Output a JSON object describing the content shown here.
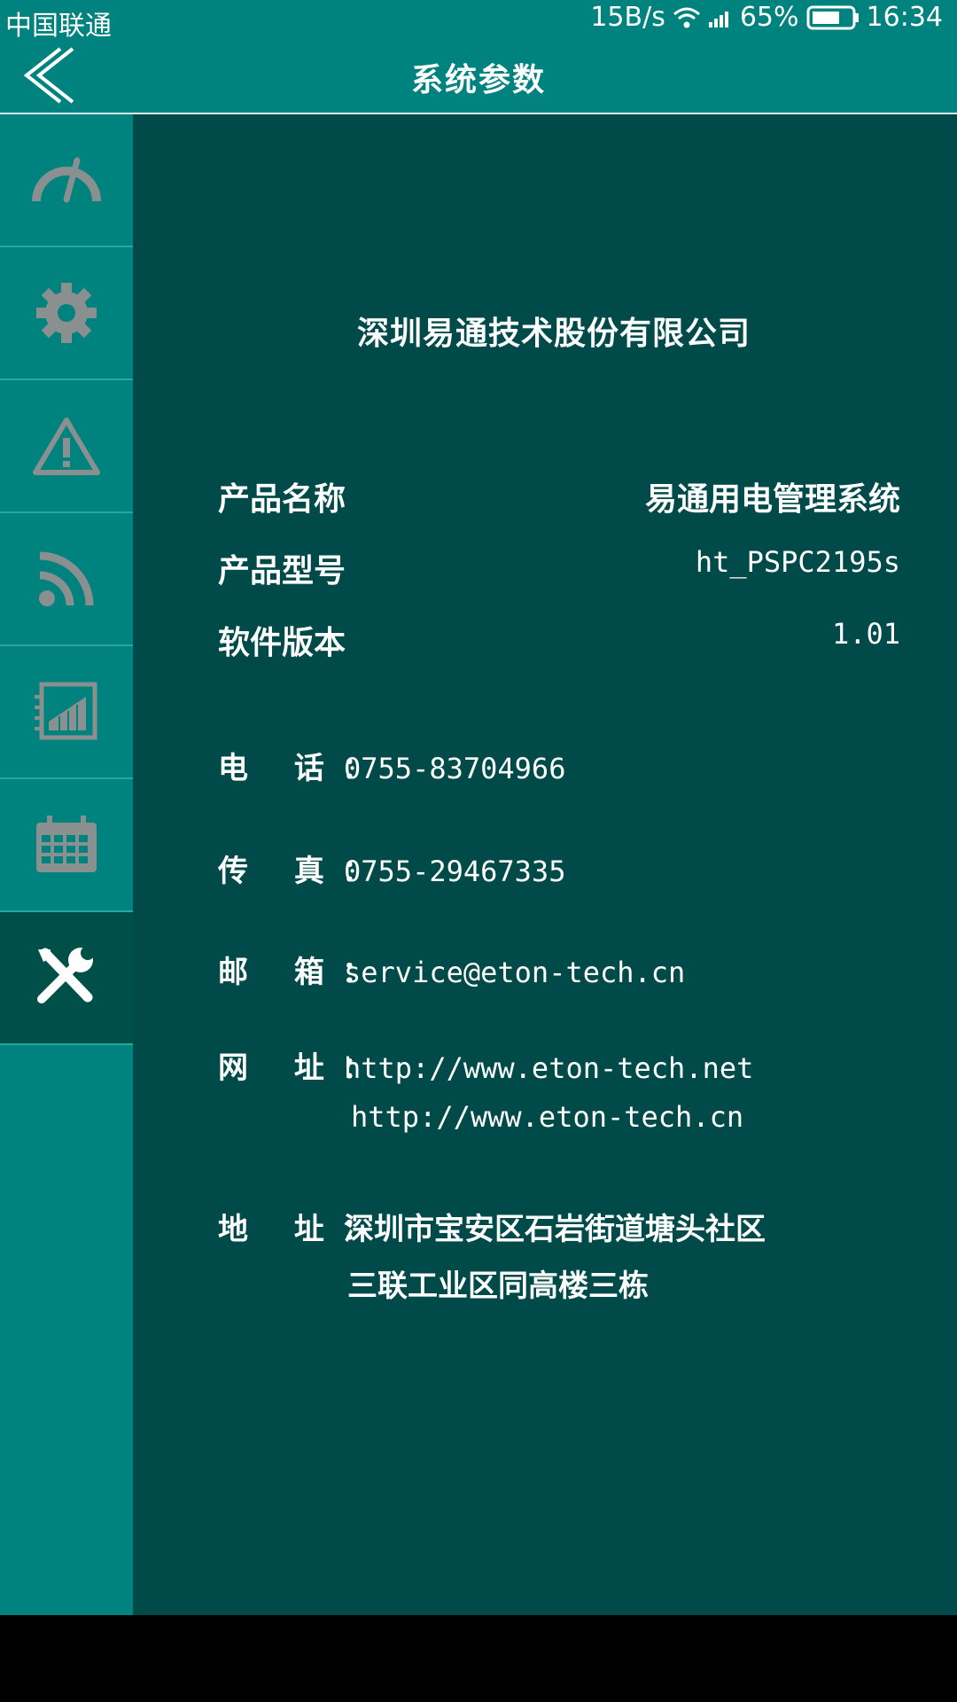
{
  "status_bar": {
    "carrier": "中国联通",
    "speed": "15B/s",
    "battery": "65%",
    "time": "16:34"
  },
  "header": {
    "title": "系统参数"
  },
  "sidebar": {
    "items": [
      {
        "icon": "speedometer-icon",
        "active": false
      },
      {
        "icon": "gear-icon",
        "active": false
      },
      {
        "icon": "warning-icon",
        "active": false
      },
      {
        "icon": "rss-icon",
        "active": false
      },
      {
        "icon": "report-icon",
        "active": false
      },
      {
        "icon": "calendar-icon",
        "active": false
      },
      {
        "icon": "tools-icon",
        "active": true
      }
    ]
  },
  "content": {
    "company": "深圳易通技术股份有限公司",
    "product": [
      {
        "label": "产品名称",
        "value": "易通用电管理系统"
      },
      {
        "label": "产品型号",
        "value": "ht_PSPC2195s"
      },
      {
        "label": "软件版本",
        "value": "1.01"
      }
    ],
    "contact": {
      "phone_label": "电 话：",
      "phone": "0755-83704966",
      "fax_label": "传 真：",
      "fax": "0755-29467335",
      "email_label": "邮 箱：",
      "email": "service@eton-tech.cn",
      "web_label": "网 址：",
      "web1": "http://www.eton-tech.net",
      "web2": "http://www.eton-tech.cn",
      "address_label": "地 址：",
      "address1": "深圳市宝安区石岩街道塘头社区",
      "address2": "三联工业区同高楼三栋"
    }
  },
  "colors": {
    "header_bg": "#00827e",
    "content_bg": "#004a4a",
    "icon_gray": "#8a8f8f"
  }
}
